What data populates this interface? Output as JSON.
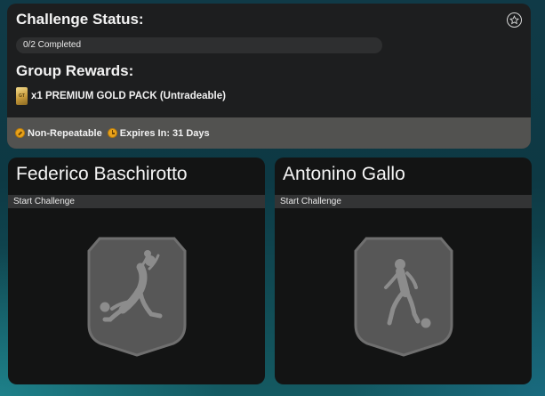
{
  "status": {
    "title": "Challenge Status:",
    "progress_text": "0/2 Completed",
    "progress_fraction": 0.0,
    "rewards_title": "Group Rewards:",
    "reward_text": "x1 PREMIUM GOLD PACK (Untradeable)",
    "pack_label": "GT",
    "repeatable_text": "Non-Repeatable",
    "expires_text": "Expires In: 31 Days"
  },
  "cards": [
    {
      "name": "Federico Baschirotto",
      "action": "Start Challenge",
      "icon": "goalkeeper-dive-silhouette-icon"
    },
    {
      "name": "Antonino Gallo",
      "action": "Start Challenge",
      "icon": "player-dribble-silhouette-icon"
    }
  ],
  "colors": {
    "panel": "#1d1e1f",
    "footer": "#525250",
    "card": "#131414",
    "badge": "#575757",
    "badge_border": "#6f6f6f",
    "coin": "#e9a21a"
  }
}
